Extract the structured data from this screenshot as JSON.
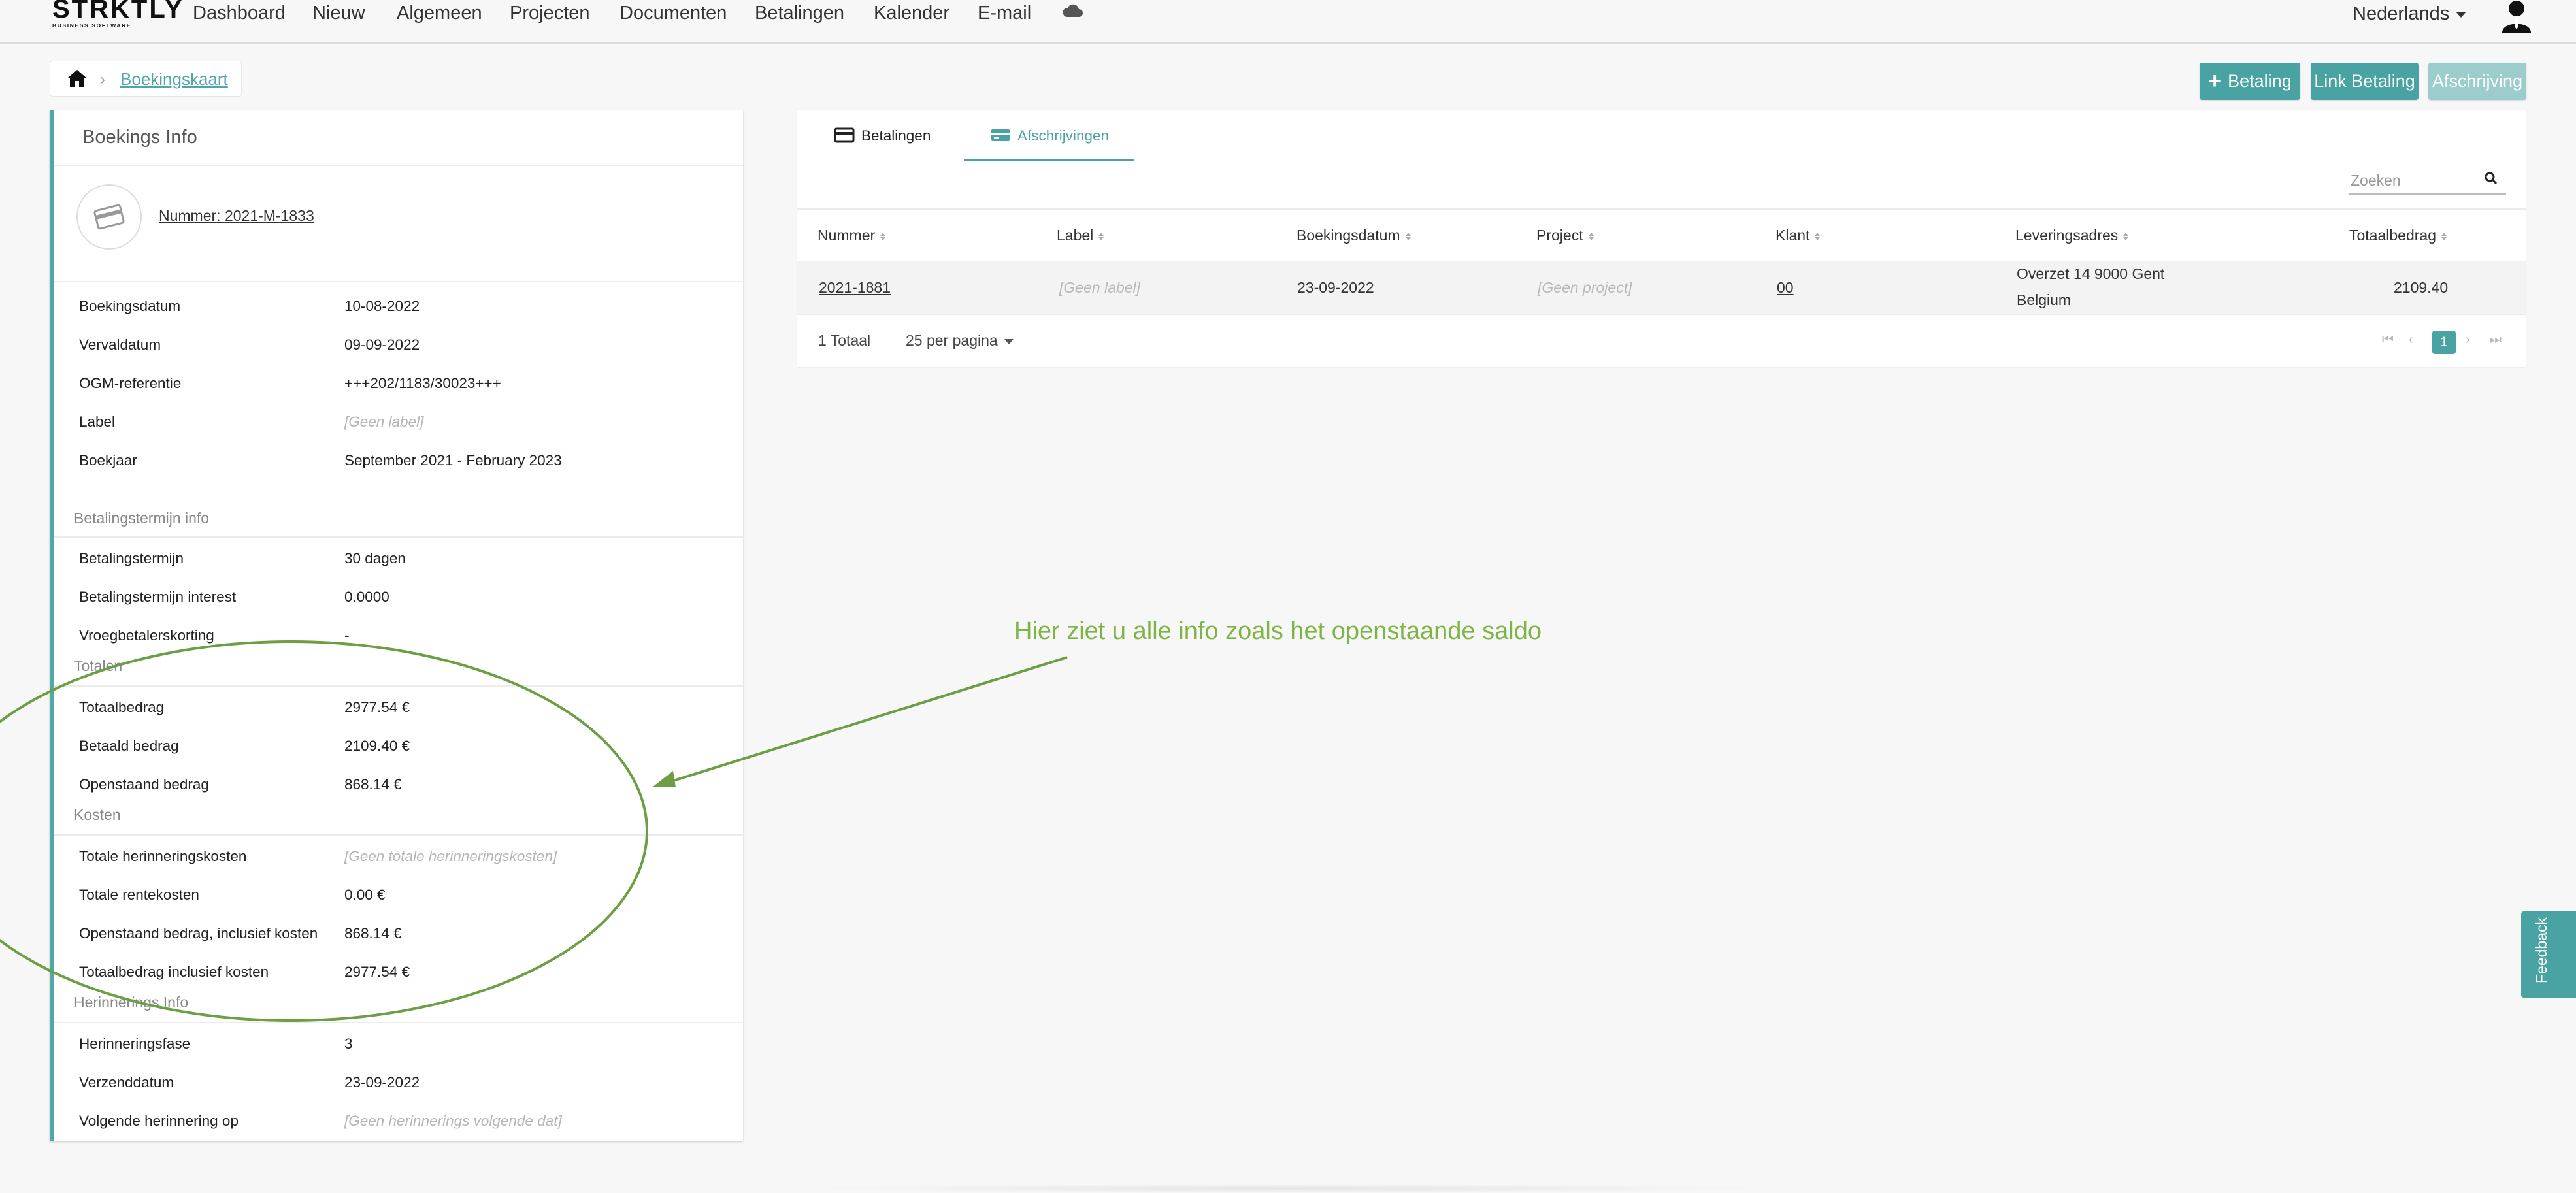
{
  "navbar": {
    "logo_word": "STRKTLY",
    "logo_sub": "BUSINESS SOFTWARE",
    "items": [
      "Dashboard",
      "Nieuw",
      "Algemeen",
      "Projecten",
      "Documenten",
      "Betalingen",
      "Kalender",
      "E-mail"
    ],
    "cloud_icon": "cloud-icon",
    "language": "Nederlands",
    "user_icon": "user-avatar-icon"
  },
  "breadcrumb": {
    "home_icon": "home-icon",
    "current": "Boekingskaart"
  },
  "actions": {
    "betaling": "Betaling",
    "link_betaling": "Link Betaling",
    "afschrijving": "Afschrijving"
  },
  "boekings_info": {
    "title": "Boekings Info",
    "nummer": "Nummer: 2021-M-1833",
    "rows": [
      {
        "label": "Boekingsdatum",
        "value": "10-08-2022"
      },
      {
        "label": "Vervaldatum",
        "value": "09-09-2022"
      },
      {
        "label": "OGM-referentie",
        "value": "+++202/1183/30023+++"
      },
      {
        "label": "Label",
        "value": "[Geen label]"
      },
      {
        "label": "Boekjaar",
        "value": "September 2021 - February 2023"
      }
    ],
    "betalingstermijn": {
      "title": "Betalingstermijn info",
      "rows": [
        {
          "label": "Betalingstermijn",
          "value": "30 dagen"
        },
        {
          "label": "Betalingstermijn interest",
          "value": "0.0000"
        },
        {
          "label": "Vroegbetalerskorting",
          "value": "-"
        }
      ]
    },
    "totalen": {
      "title": "Totalen",
      "rows": [
        {
          "label": "Totaalbedrag",
          "value": "2977.54 €"
        },
        {
          "label": "Betaald bedrag",
          "value": "2109.40 €"
        },
        {
          "label": "Openstaand bedrag",
          "value": "868.14 €"
        }
      ]
    },
    "kosten": {
      "title": "Kosten",
      "rows": [
        {
          "label": "Totale herinneringskosten",
          "value": "[Geen totale herinneringskosten]"
        },
        {
          "label": "Totale rentekosten",
          "value": "0.00 €"
        },
        {
          "label": "Openstaand bedrag, inclusief kosten",
          "value": "868.14 €"
        },
        {
          "label": "Totaalbedrag inclusief kosten",
          "value": "2977.54 €"
        }
      ]
    },
    "herinnerings": {
      "title": "Herinnerings Info",
      "rows": [
        {
          "label": "Herinneringsfase",
          "value": "3"
        },
        {
          "label": "Verzenddatum",
          "value": "23-09-2022"
        },
        {
          "label": "Volgende herinnering op",
          "value": "[Geen herinnerings volgende dat]"
        }
      ]
    }
  },
  "payments_panel": {
    "tabs": [
      {
        "label": "Betalingen",
        "icon": "credit-card-icon",
        "active": false
      },
      {
        "label": "Afschrijvingen",
        "icon": "card-debit-icon",
        "active": true
      }
    ],
    "search_placeholder": "Zoeken",
    "columns": [
      "Nummer",
      "Label",
      "Boekingsdatum",
      "Project",
      "Klant",
      "Leveringsadres",
      "Totaalbedrag"
    ],
    "rows": [
      {
        "nummer": "2021-1881",
        "label": "[Geen label]",
        "boekingsdatum": "23-09-2022",
        "project": "[Geen project]",
        "klant": "00",
        "adres_line1": "Overzet 14 9000 Gent",
        "adres_line2": "Belgium",
        "totaalbedrag": "2109.40"
      }
    ],
    "total_text": "1 Totaal",
    "per_page": "25 per pagina",
    "current_page": "1"
  },
  "annotation": {
    "text": "Hier ziet u alle info zoals het openstaande saldo",
    "color": "#7db544"
  },
  "feedback": "Feedback",
  "colors": {
    "accent": "#4aa3a3",
    "annotation": "#7db544"
  }
}
